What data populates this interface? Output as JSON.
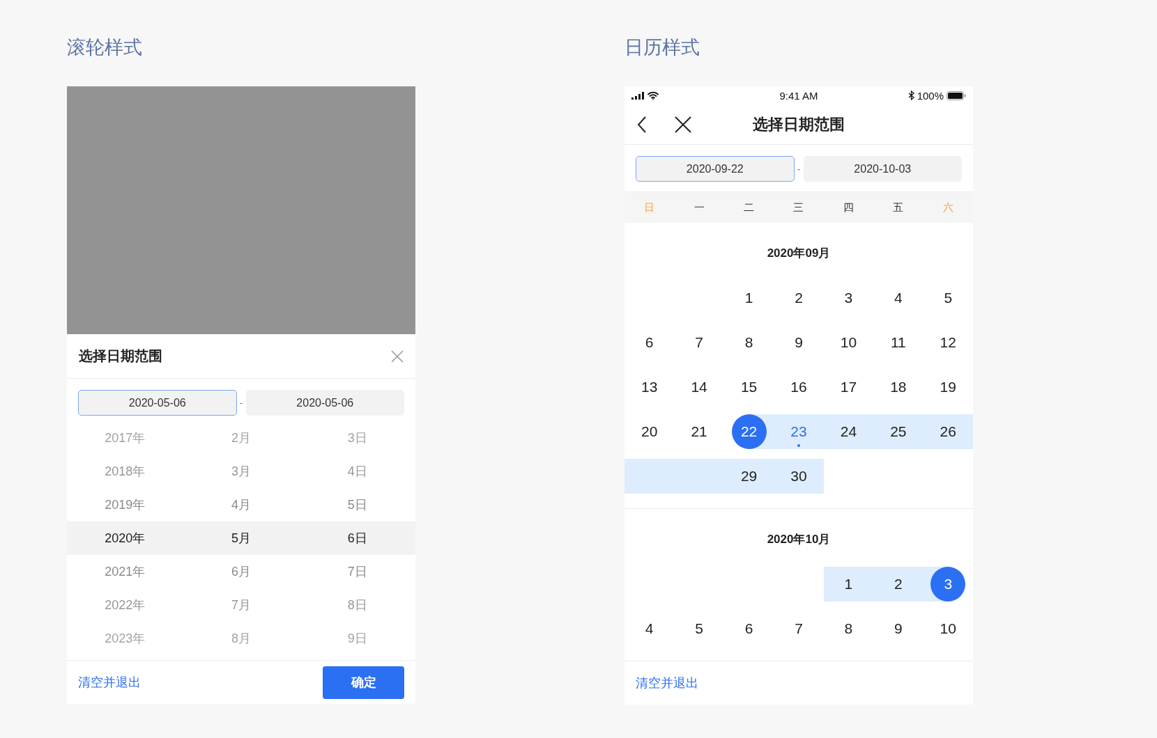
{
  "wheel_section": {
    "heading": "滚轮样式",
    "sheet_title": "选择日期范围",
    "fields": [
      {
        "value": "2020-05-06",
        "selected": true
      },
      {
        "value": "2020-05-06",
        "selected": false
      }
    ],
    "separator": "-",
    "rows": [
      {
        "year": "2017年",
        "month": "2月",
        "day": "3日",
        "selected": false
      },
      {
        "year": "2018年",
        "month": "3月",
        "day": "4日",
        "selected": false
      },
      {
        "year": "2019年",
        "month": "4月",
        "day": "5日",
        "selected": false
      },
      {
        "year": "2020年",
        "month": "5月",
        "day": "6日",
        "selected": true
      },
      {
        "year": "2021年",
        "month": "6月",
        "day": "7日",
        "selected": false
      },
      {
        "year": "2022年",
        "month": "7月",
        "day": "8日",
        "selected": false
      },
      {
        "year": "2023年",
        "month": "8月",
        "day": "9日",
        "selected": false
      }
    ],
    "clear_link": "清空并退出",
    "confirm_button": "确定"
  },
  "calendar_section": {
    "heading": "日历样式",
    "status_bar": {
      "time": "9:41 AM",
      "battery": "100%"
    },
    "title": "选择日期范围",
    "fields": [
      {
        "value": "2020-09-22",
        "selected": true
      },
      {
        "value": "2020-10-03",
        "selected": false
      }
    ],
    "separator": "-",
    "weekdays": [
      {
        "label": "日",
        "weekend": true
      },
      {
        "label": "一",
        "weekend": false
      },
      {
        "label": "二",
        "weekend": false
      },
      {
        "label": "三",
        "weekend": false
      },
      {
        "label": "四",
        "weekend": false
      },
      {
        "label": "五",
        "weekend": false
      },
      {
        "label": "六",
        "weekend": true
      }
    ],
    "months": [
      {
        "title": "2020年09月",
        "weeks": [
          [
            {
              "in_range": false
            },
            {
              "in_range": false
            },
            {
              "day": "1",
              "selected": false,
              "in_range": false,
              "today": false
            },
            {
              "day": "2",
              "selected": false,
              "in_range": false,
              "today": false
            },
            {
              "day": "3",
              "selected": false,
              "in_range": false,
              "today": false
            },
            {
              "day": "4",
              "selected": false,
              "in_range": false,
              "today": false
            },
            {
              "day": "5",
              "selected": false,
              "in_range": false,
              "today": false
            }
          ],
          [
            {
              "day": "6",
              "selected": false,
              "in_range": false,
              "today": false
            },
            {
              "day": "7",
              "selected": false,
              "in_range": false,
              "today": false
            },
            {
              "day": "8",
              "selected": false,
              "in_range": false,
              "today": false
            },
            {
              "day": "9",
              "selected": false,
              "in_range": false,
              "today": false
            },
            {
              "day": "10",
              "selected": false,
              "in_range": false,
              "today": false
            },
            {
              "day": "11",
              "selected": false,
              "in_range": false,
              "today": false
            },
            {
              "day": "12",
              "selected": false,
              "in_range": false,
              "today": false
            }
          ],
          [
            {
              "day": "13",
              "selected": false,
              "in_range": false,
              "today": false
            },
            {
              "day": "14",
              "selected": false,
              "in_range": false,
              "today": false
            },
            {
              "day": "15",
              "selected": false,
              "in_range": false,
              "today": false
            },
            {
              "day": "16",
              "selected": false,
              "in_range": false,
              "today": false
            },
            {
              "day": "17",
              "selected": false,
              "in_range": false,
              "today": false
            },
            {
              "day": "18",
              "selected": false,
              "in_range": false,
              "today": false
            },
            {
              "day": "19",
              "selected": false,
              "in_range": false,
              "today": false
            }
          ],
          [
            {
              "day": "20",
              "selected": false,
              "in_range": false,
              "today": false
            },
            {
              "day": "21",
              "selected": false,
              "in_range": false,
              "today": false
            },
            {
              "day": "22",
              "selected": true,
              "in_range": false,
              "today": false
            },
            {
              "day": "23",
              "selected": false,
              "in_range": true,
              "today": true
            },
            {
              "day": "24",
              "selected": false,
              "in_range": true,
              "today": false
            },
            {
              "day": "25",
              "selected": false,
              "in_range": true,
              "today": false
            },
            {
              "day": "26",
              "selected": false,
              "in_range": true,
              "today": false
            }
          ],
          [
            {
              "in_range": true
            },
            {
              "in_range": true
            },
            {
              "day": "29",
              "selected": false,
              "in_range": true,
              "today": false
            },
            {
              "day": "30",
              "selected": false,
              "in_range": true,
              "today": false
            },
            {
              "in_range": false
            },
            {
              "in_range": false
            },
            {
              "in_range": false
            }
          ]
        ]
      },
      {
        "title": "2020年10月",
        "weeks": [
          [
            {
              "in_range": false
            },
            {
              "in_range": false
            },
            {
              "in_range": false
            },
            {
              "in_range": false
            },
            {
              "day": "1",
              "selected": false,
              "in_range": true,
              "today": false
            },
            {
              "day": "2",
              "selected": false,
              "in_range": true,
              "today": false
            },
            {
              "day": "3",
              "selected": true,
              "in_range": false,
              "today": false
            }
          ],
          [
            {
              "day": "4",
              "selected": false,
              "in_range": false,
              "today": false
            },
            {
              "day": "5",
              "selected": false,
              "in_range": false,
              "today": false
            },
            {
              "day": "6",
              "selected": false,
              "in_range": false,
              "today": false
            },
            {
              "day": "7",
              "selected": false,
              "in_range": false,
              "today": false
            },
            {
              "day": "8",
              "selected": false,
              "in_range": false,
              "today": false
            },
            {
              "day": "9",
              "selected": false,
              "in_range": false,
              "today": false
            },
            {
              "day": "10",
              "selected": false,
              "in_range": false,
              "today": false
            }
          ]
        ]
      }
    ],
    "clear_link": "清空并退出"
  }
}
